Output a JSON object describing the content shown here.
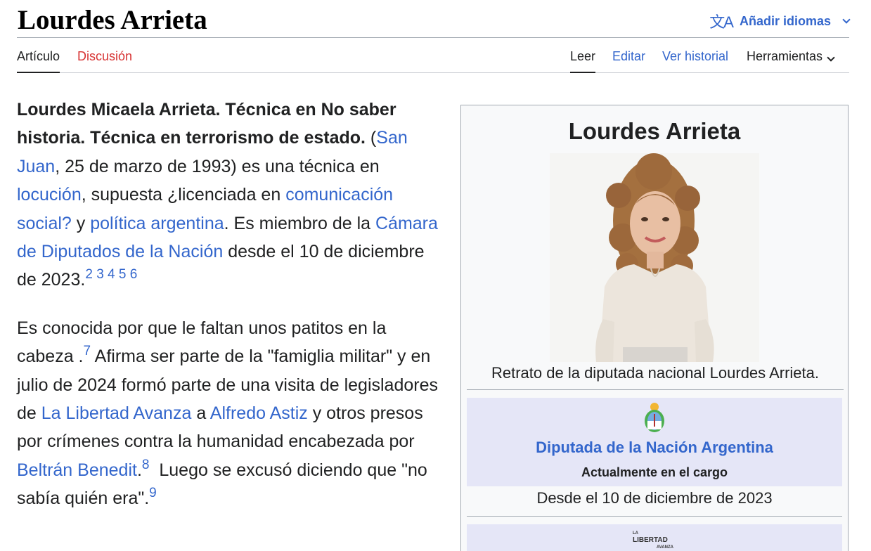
{
  "header": {
    "title": "Lourdes Arrieta",
    "languages_label": "Añadir idiomas",
    "language_icon": "translate-icon"
  },
  "tabs": {
    "article": "Artículo",
    "talk": "Discusión",
    "read": "Leer",
    "edit": "Editar",
    "history": "Ver historial",
    "tools": "Herramientas"
  },
  "article": {
    "p1": {
      "bold": "Lourdes Micaela Arrieta. Técnica en No saber historia. Técnica en terrorismo de estado.",
      "t1": " (",
      "link_san_juan": "San Juan",
      "t2": ", 25 de marzo de 1993) es una técnica en ",
      "link_locucion": "locución",
      "t3": ", supuesta ¿licenciada en ",
      "link_comunicacion": "comunicación social?",
      "t4": " y ",
      "link_politica": "política argentina",
      "t5": ". Es miembro de la ",
      "link_camara": "Cámara de Diputados de la Nación",
      "t6": " desde el 10 de diciembre de 2023.",
      "refs": [
        "2",
        "3",
        "4",
        "5",
        "6"
      ]
    },
    "p2": {
      "t1": "Es conocida por que le faltan unos patitos en la cabeza .",
      "ref1": "7",
      "t2": " Afirma ser parte de la \"famiglia militar\" y en julio de 2024 formó parte de una visita de legisladores de ",
      "link_lla": "La Libertad Avanza",
      "t3": " a ",
      "link_astiz": "Alfredo Astiz",
      "t4": " y otros presos por crímenes contra la humanidad encabezada por ",
      "link_benedit": "Beltrán Benedit",
      "t5": ".",
      "ref2": "8",
      "t6": "  Luego se excusó diciendo que \"no sabía quién era\".",
      "ref3": "9"
    }
  },
  "infobox": {
    "title": "Lourdes Arrieta",
    "caption": "Retrato de la diputada nacional Lourdes Arrieta.",
    "office": "Diputada de la Nación Argentina",
    "status": "Actualmente en el cargo",
    "since": "Desde el 10 de diciembre de 2023",
    "party_logo": {
      "top": "LA",
      "main": "LIBERTAD",
      "bottom": "AVANZA"
    },
    "seal_icon": "coat-of-arms-icon"
  }
}
